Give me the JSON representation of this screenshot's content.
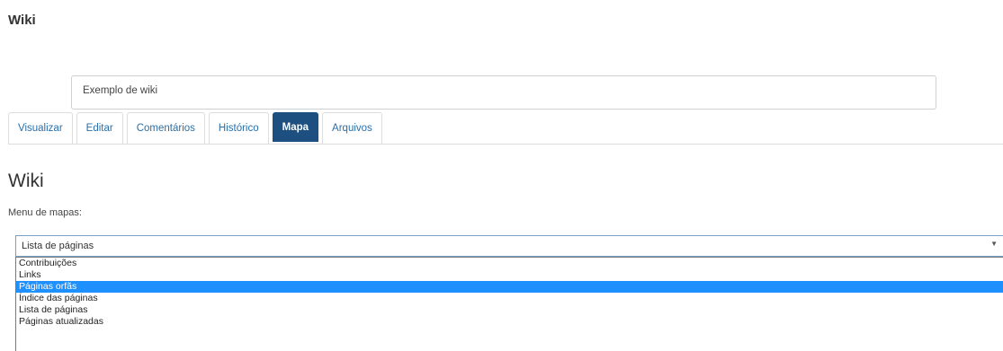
{
  "header": {
    "title": "Wiki"
  },
  "intro": {
    "text": "Exemplo de wiki"
  },
  "tabs": [
    {
      "label": "Visualizar",
      "active": false
    },
    {
      "label": "Editar",
      "active": false
    },
    {
      "label": "Comentários",
      "active": false
    },
    {
      "label": "Histórico",
      "active": false
    },
    {
      "label": "Mapa",
      "active": true
    },
    {
      "label": "Arquivos",
      "active": false
    }
  ],
  "main": {
    "title": "Wiki",
    "map_menu_label": "Menu de mapas:",
    "map_select": {
      "selected_value": "Lista de páginas",
      "caret": "▼",
      "options": [
        "Contribuições",
        "Links",
        "Páginas orfãs",
        "Índice das páginas",
        "Lista de páginas",
        "Páginas atualizadas"
      ],
      "highlighted_option_index": 2
    }
  },
  "colors": {
    "active_tab_bg": "#1d4f80",
    "tab_link": "#2a6fa8",
    "dropdown_highlight": "#1e90ff"
  }
}
